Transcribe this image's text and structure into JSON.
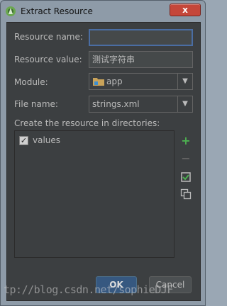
{
  "window": {
    "title": "Extract Resource",
    "close_glyph": "x"
  },
  "form": {
    "resource_name": {
      "label": "Resource name:",
      "value": ""
    },
    "resource_value": {
      "label": "Resource value:",
      "value": "测试字符串"
    },
    "module": {
      "label": "Module:",
      "value": "app",
      "icon": "folder-module-icon"
    },
    "file_name": {
      "label": "File name:",
      "value": "strings.xml"
    }
  },
  "directories": {
    "label": "Create the resource in directories:",
    "items": [
      {
        "label": "values",
        "checked": true
      }
    ],
    "actions": [
      {
        "name": "add",
        "glyph": "+",
        "color": "#4caf50"
      },
      {
        "name": "remove",
        "glyph": "−",
        "color": "#6e6e6e"
      },
      {
        "name": "select-all",
        "icon": "check-all-icon"
      },
      {
        "name": "unselect-all",
        "icon": "copy-icon"
      }
    ]
  },
  "buttons": {
    "ok": "OK",
    "cancel": "Cancel"
  },
  "watermark": "tp://blog.csdn.net/sophieDJF",
  "colors": {
    "panel": "#3c3f41",
    "focus": "#4a6da3",
    "ok": "#365880"
  }
}
